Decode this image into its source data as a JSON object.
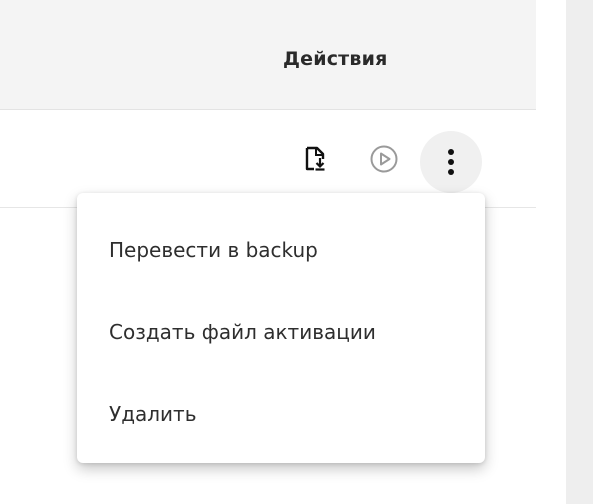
{
  "table": {
    "header": {
      "actions_label": "Действия"
    },
    "row": {
      "actions": {
        "download_icon": "file-download-icon",
        "play_icon": "play-circle-icon",
        "more_icon": "more-vertical-icon"
      }
    }
  },
  "context_menu": {
    "items": [
      {
        "label": "Перевести в backup"
      },
      {
        "label": "Создать файл активации"
      },
      {
        "label": "Удалить"
      }
    ]
  },
  "colors": {
    "header_bg": "#f4f4f4",
    "menu_bg": "#ffffff",
    "text": "#2e2e2e",
    "icon_dark": "#111111",
    "icon_muted": "#9a9a9a",
    "gutter": "#eeeeee"
  }
}
